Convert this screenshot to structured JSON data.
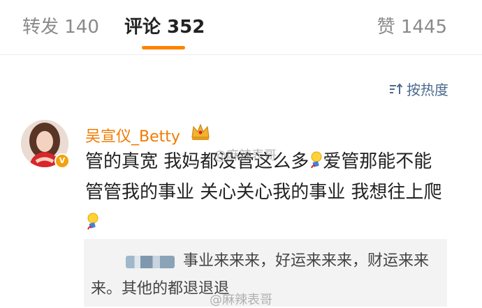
{
  "tabs": {
    "repost": "转发 140",
    "comments": "评论 352",
    "likes": "赞 1445",
    "active": "comments",
    "accent": "#ff8200"
  },
  "sort": {
    "label": "按热度",
    "icon": "sort-icon"
  },
  "comment": {
    "username": "吴宣仪_Betty",
    "username_color": "#f07b00",
    "badge_icon": "verified-v-badge",
    "crown_icon": "crown-icon",
    "text_part1": "管的真宽 我妈都没管这么多",
    "text_part2": "爱管那能不能管管我的事业 关心关心我的事业 我想往上爬",
    "emoji_icon": "lightbulb-emoji"
  },
  "reply": {
    "text": "事业来来来，好运来来来，财运来来来。其他的都退退退"
  },
  "watermark": {
    "text": "@麻辣表哥"
  }
}
